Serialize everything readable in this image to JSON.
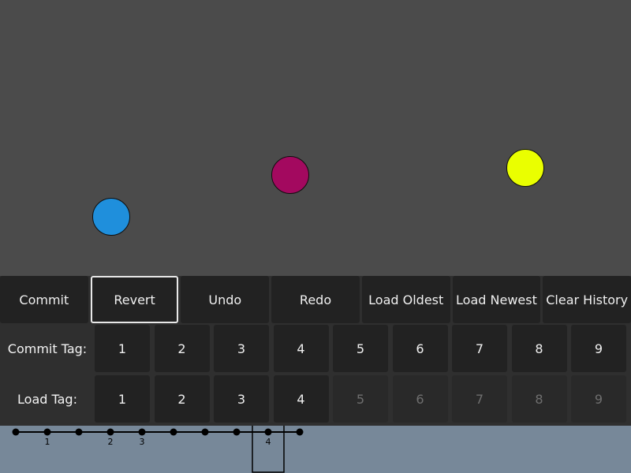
{
  "balls": [
    {
      "name": "blue",
      "color": "#1f8fdc"
    },
    {
      "name": "purple",
      "color": "#a3095f"
    },
    {
      "name": "yellow",
      "color": "#eaff00"
    }
  ],
  "actions": {
    "commit": "Commit",
    "revert": "Revert",
    "undo": "Undo",
    "redo": "Redo",
    "load_oldest": "Load Oldest",
    "load_newest": "Load Newest",
    "clear_history": "Clear History",
    "active": "revert"
  },
  "commit_tag": {
    "label": "Commit Tag:",
    "tags": [
      "1",
      "2",
      "3",
      "4",
      "5",
      "6",
      "7",
      "8",
      "9"
    ]
  },
  "load_tag": {
    "label": "Load Tag:",
    "tags": [
      "1",
      "2",
      "3",
      "4",
      "5",
      "6",
      "7",
      "8",
      "9"
    ],
    "enabled_count": 4
  },
  "timeline": {
    "tag_labels": [
      "1",
      "2",
      "3",
      "4"
    ],
    "tagged_node_indices": [
      1,
      3,
      4,
      8
    ],
    "current_node_index": 8
  }
}
